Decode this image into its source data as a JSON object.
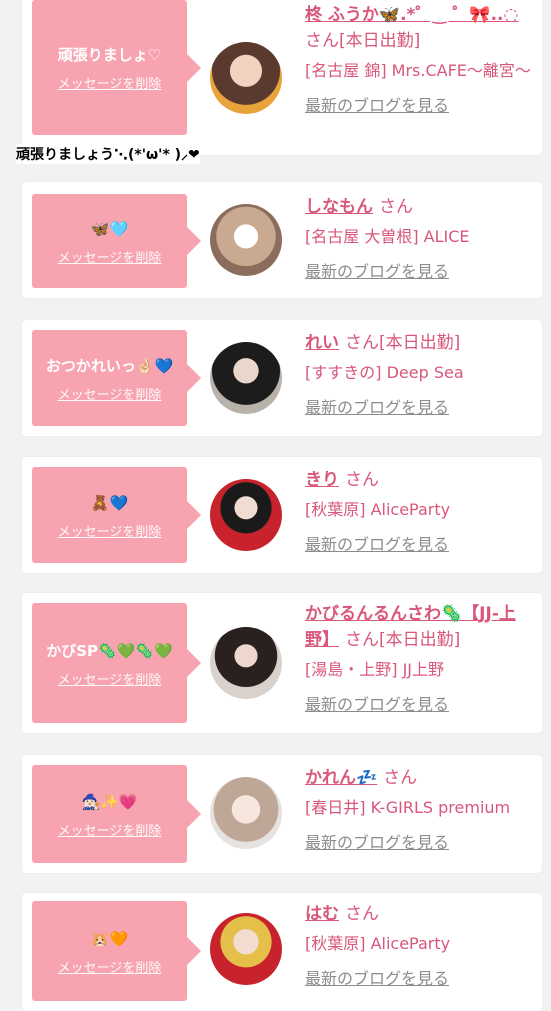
{
  "float_note": "頑張りましょう⋱(*'ω'* )⸝❤︎",
  "del_label": "メッセージを削除",
  "blog_label": "最新のブログを見る",
  "san": "さん",
  "cards": [
    {
      "msg": "頑張りましょ♡",
      "name": "柊 ふうか🦋.*゜‿ ゜🎀..◌",
      "status": "[本日出勤]",
      "shop": "[名古屋 錦] Mrs.CAFE〜離宮〜"
    },
    {
      "msg": "🦋🩵",
      "name": "しなもん",
      "status": "",
      "shop": "[名古屋 大曽根] ALICE"
    },
    {
      "msg": "おつかれいっ🤞🏻💙",
      "name": "れい",
      "status": "[本日出勤]",
      "shop": "[すすきの] Deep Sea"
    },
    {
      "msg": "🧸💙",
      "name": "きり",
      "status": "",
      "shop": "[秋葉原] AliceParty"
    },
    {
      "msg": "かびSP🦠💚🦠💚",
      "name": "かびるんるんさわ🦠【JJ-上野】",
      "status": "[本日出勤]",
      "shop": "[湯島・上野] JJ上野"
    },
    {
      "msg": "🧙🏻‍♀️✨💗",
      "name": "かれん💤",
      "status": "",
      "shop": "[春日井] K-GIRLS premium"
    },
    {
      "msg": "🐹🧡",
      "name": "はむ",
      "status": "",
      "shop": "[秋葉原] AliceParty"
    }
  ]
}
